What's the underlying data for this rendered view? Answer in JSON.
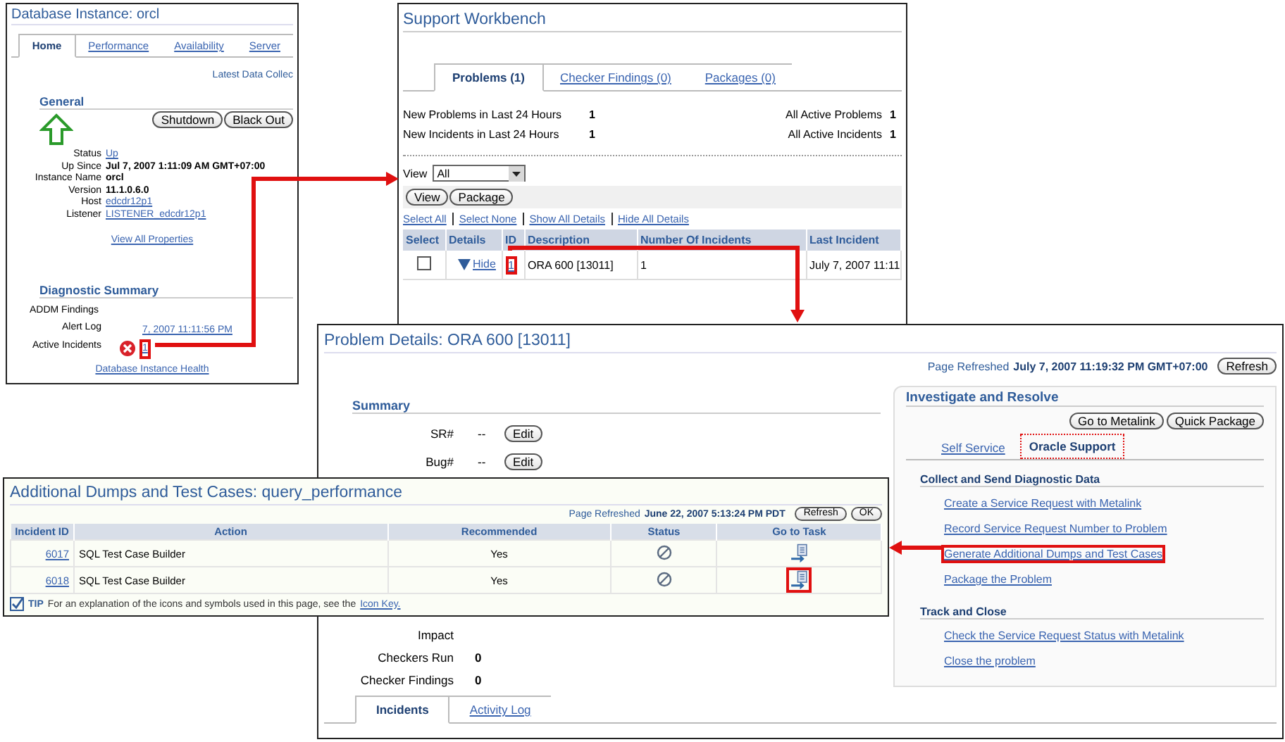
{
  "db_instance": {
    "title": "Database Instance: orcl",
    "tabs": [
      {
        "label": "Home",
        "selected": true
      },
      {
        "label": "Performance",
        "selected": false
      },
      {
        "label": "Availability",
        "selected": false
      },
      {
        "label": "Server",
        "selected": false
      }
    ],
    "latest_data": "Latest Data Collec",
    "general": {
      "heading": "General",
      "buttons": [
        "Shutdown",
        "Black Out"
      ],
      "properties": [
        {
          "label": "Status",
          "value": "Up",
          "kind": "link"
        },
        {
          "label": "Up Since",
          "value": "Jul 7, 2007 1:11:09 AM GMT+07:00",
          "kind": "text"
        },
        {
          "label": "Instance Name",
          "value": "orcl",
          "kind": "text"
        },
        {
          "label": "Version",
          "value": "11.1.0.6.0",
          "kind": "text"
        },
        {
          "label": "Host",
          "value": "edcdr12p1",
          "kind": "link"
        },
        {
          "label": "Listener",
          "value": "LISTENER_edcdr12p1",
          "kind": "link"
        }
      ],
      "view_all": "View All Properties"
    },
    "diagnostic_summary": {
      "heading": "Diagnostic Summary",
      "rows": [
        {
          "label": "ADDM Findings",
          "kind": "empty",
          "highlighted": false
        },
        {
          "label": "Alert Log",
          "value": "7, 2007 11:11:56 PM",
          "kind": "link",
          "highlighted": false
        },
        {
          "label": "Active Incidents",
          "value": "1",
          "kind": "error",
          "highlighted": true
        }
      ],
      "health_link": "Database Instance Health"
    }
  },
  "support_workbench": {
    "title": "Support Workbench",
    "tabs": [
      {
        "label": "Problems (1)",
        "selected": true
      },
      {
        "label": "Checker Findings (0)",
        "selected": false
      },
      {
        "label": "Packages (0)",
        "selected": false
      }
    ],
    "stats": [
      {
        "label": "New Problems in Last 24 Hours",
        "value": "1"
      },
      {
        "label": "All Active Problems",
        "value": "1"
      },
      {
        "label": "New Incidents in Last 24 Hours",
        "value": "1"
      },
      {
        "label": "All Active Incidents",
        "value": "1"
      }
    ],
    "view_label": "View",
    "view_value": "All",
    "buttons": [
      "View",
      "Package"
    ],
    "selection_links": [
      "Select All",
      "Select None",
      "Show All Details",
      "Hide All Details"
    ],
    "columns": [
      "Select",
      "Details",
      "ID",
      "Description",
      "Number Of Incidents",
      "Last Incident"
    ],
    "rows": [
      {
        "checked": false,
        "details": "Hide",
        "id": "1",
        "id_highlighted": true,
        "description": "ORA 600 [13011]",
        "incidents": "1",
        "last_incident": "July 7, 2007 11:11"
      }
    ]
  },
  "problem_details": {
    "title": "Problem Details: ORA 600 [13011]",
    "refreshed_label": "Page Refreshed",
    "refreshed_value": "July 7, 2007 11:19:32 PM GMT+07:00",
    "refresh_button": "Refresh",
    "summary": {
      "heading": "Summary",
      "editable": [
        {
          "label": "SR#",
          "value": "--",
          "button": "Edit"
        },
        {
          "label": "Bug#",
          "value": "--",
          "button": "Edit"
        }
      ],
      "facts": [
        {
          "label": "Impact"
        },
        {
          "label": "Checkers Run",
          "value": "0"
        },
        {
          "label": "Checker Findings",
          "value": "0"
        }
      ]
    },
    "investigate": {
      "title": "Investigate and Resolve",
      "buttons": [
        "Go to Metalink",
        "Quick Package"
      ],
      "tabs": [
        {
          "label": "Self Service",
          "selected": false
        },
        {
          "label": "Oracle Support",
          "selected": true
        }
      ],
      "sections": [
        {
          "heading": "Collect and Send Diagnostic Data",
          "links": [
            {
              "label": "Create a Service Request with Metalink",
              "highlighted": false
            },
            {
              "label": "Record Service Request Number to Problem",
              "highlighted": false
            },
            {
              "label": "Generate Additional Dumps and Test Cases",
              "highlighted": true
            },
            {
              "label": "Package the Problem",
              "highlighted": false
            }
          ]
        },
        {
          "heading": "Track and Close",
          "links": [
            {
              "label": "Check the Service Request Status with Metalink",
              "highlighted": false
            },
            {
              "label": "Close the problem",
              "highlighted": false
            }
          ]
        }
      ]
    },
    "bottom_tabs": [
      {
        "label": "Incidents",
        "selected": true
      },
      {
        "label": "Activity Log",
        "selected": false
      }
    ]
  },
  "additional_dumps": {
    "title": "Additional Dumps and Test Cases: query_performance",
    "refreshed_label": "Page Refreshed",
    "refreshed_value": "June 22, 2007 5:13:24 PM PDT",
    "buttons": [
      "Refresh",
      "OK"
    ],
    "columns": [
      "Incident ID",
      "Action",
      "Recommended",
      "Status",
      "Go to Task"
    ],
    "rows": [
      {
        "incident_id": "6017",
        "action": "SQL Test Case Builder",
        "recommended": "Yes",
        "task_highlighted": false
      },
      {
        "incident_id": "6018",
        "action": "SQL Test Case Builder",
        "recommended": "Yes",
        "task_highlighted": true
      }
    ],
    "tip_label": "TIP",
    "tip_text": "For an explanation of the icons and symbols used in this page, see the",
    "tip_link": "Icon Key."
  }
}
